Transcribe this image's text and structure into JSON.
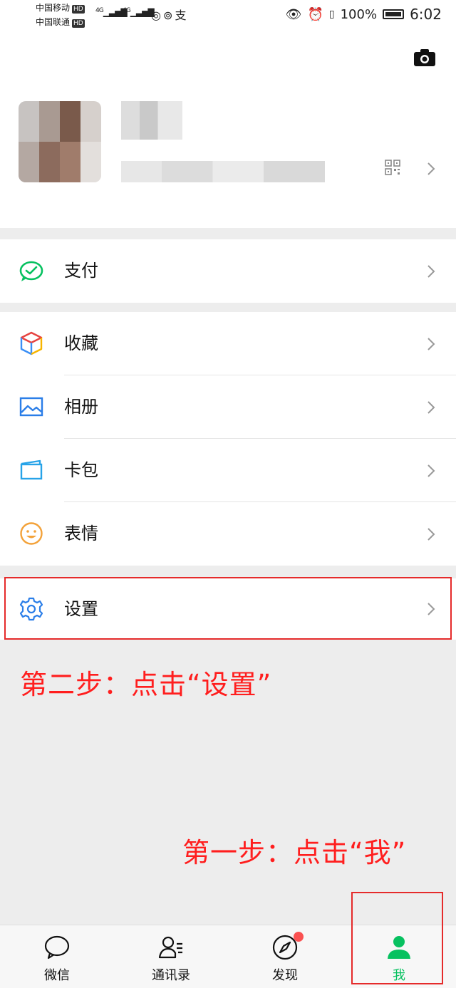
{
  "status_bar": {
    "carrier1": "中国移动",
    "carrier2": "中国联通",
    "hd_badge": "HD",
    "net1": "4G",
    "net2": "4G",
    "battery": "100%",
    "time": "6:02"
  },
  "menu": {
    "pay": "支付",
    "favorites": "收藏",
    "album": "相册",
    "cards": "卡包",
    "stickers": "表情",
    "settings": "设置"
  },
  "annotations": {
    "step2": "第二步：点击“设置”",
    "step1": "第一步：点击“我”"
  },
  "tabbar": {
    "chats": "微信",
    "contacts": "通讯录",
    "discover": "发现",
    "me": "我"
  },
  "colors": {
    "brand_green": "#07c160",
    "annotation_red": "#ff1e1e",
    "badge_red": "#fa5151"
  }
}
